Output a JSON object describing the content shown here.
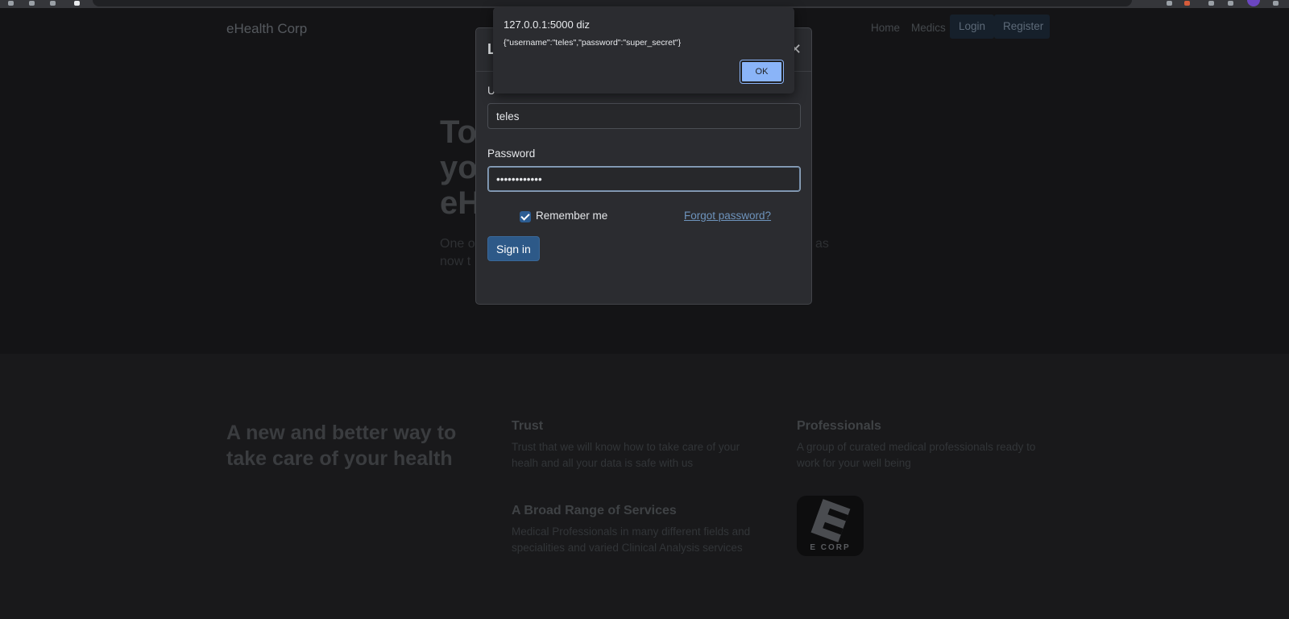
{
  "alert": {
    "origin": "127.0.0.1:5000 diz",
    "message": "{\"username\":\"teles\",\"password\":\"super_secret\"}",
    "ok_label": "OK"
  },
  "navbar": {
    "brand": "eHealth Corp",
    "links": [
      "Home",
      "Medics"
    ],
    "buttons": [
      "Login",
      "Register"
    ]
  },
  "hero": {
    "title_lines": [
      "To",
      "yo",
      "eH"
    ],
    "lead_lines": [
      "One o",
      "now t",
      "as"
    ]
  },
  "modal": {
    "title": "L",
    "close_icon": "close-icon",
    "username_label": "U",
    "username_value": "teles",
    "password_label": "Password",
    "password_value": "super_secret",
    "remember_label": "Remember me",
    "remember_checked": true,
    "forgot_label": "Forgot password?",
    "sign_in_label": "Sign in"
  },
  "features": {
    "heading": "A new and better way to take care of your health",
    "items": [
      {
        "title": "Trust",
        "text_lines": [
          "Trust that we will know how to take care of your",
          "healh and all your data is safe with us"
        ]
      },
      {
        "title": "Professionals",
        "text_lines": [
          "A group of curated medical professionals ready to",
          "work for your well being"
        ]
      },
      {
        "title": "A Broad Range of Services",
        "text_lines": [
          "Medical Professionals in many different fields and",
          "specialities and varied Clinical Analysis services"
        ]
      }
    ],
    "logo_text": "E CORP"
  },
  "colors": {
    "accent": "#2d5988",
    "alert_button": "#8ab4f8",
    "link": "#6e94bd"
  }
}
